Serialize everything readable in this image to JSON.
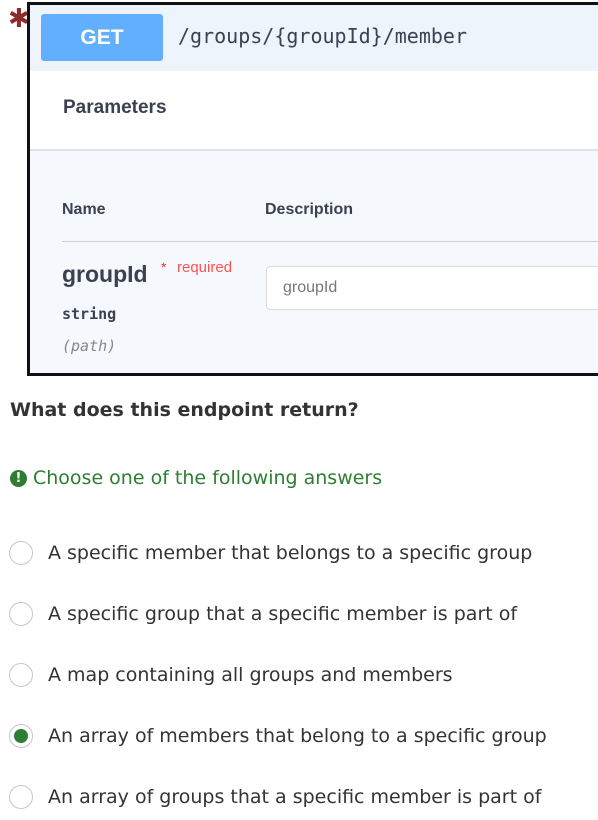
{
  "marker": "✱",
  "swagger": {
    "method": "GET",
    "path": "/groups/{groupId}/member",
    "parameters_title": "Parameters",
    "columns": {
      "name": "Name",
      "description": "Description"
    },
    "param": {
      "name": "groupId",
      "required_star": "*",
      "required_label": "required",
      "type": "string",
      "in": "(path)",
      "placeholder": "groupId"
    }
  },
  "question": "What does this endpoint return?",
  "hint": {
    "icon": "!",
    "text": "Choose one of the following answers"
  },
  "options": [
    {
      "label": "A specific member that belongs to a specific group",
      "selected": false
    },
    {
      "label": "A specific group that a specific member is part of",
      "selected": false
    },
    {
      "label": "A map containing all groups and members",
      "selected": false
    },
    {
      "label": "An array of members that belong to a specific group",
      "selected": true
    },
    {
      "label": "An array of groups that a specific member is part of",
      "selected": false
    }
  ],
  "colors": {
    "method_badge": "#61affe",
    "header_bg": "#eef4fb",
    "required": "#ff5252",
    "hint_green": "#2e7d32",
    "marker": "#8b2c2c"
  }
}
